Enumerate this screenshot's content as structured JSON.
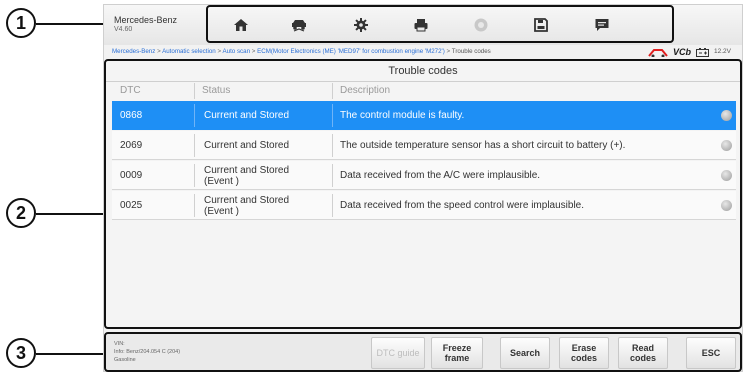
{
  "callouts": [
    "1",
    "2",
    "3"
  ],
  "app": {
    "name": "Mercedes-Benz",
    "version": "V4.60"
  },
  "toolbar": {
    "buttons": [
      {
        "icon": "home-icon"
      },
      {
        "icon": "vehicle-swap-icon"
      },
      {
        "icon": "gear-icon"
      },
      {
        "icon": "printer-icon"
      },
      {
        "icon": "help-icon"
      },
      {
        "icon": "save-icon"
      },
      {
        "icon": "message-icon"
      }
    ]
  },
  "breadcrumb": {
    "items": [
      "Mercedes-Benz",
      "Automatic selection",
      "Auto scan",
      "ECM(Motor Electronics (ME) 'MED97' for combustion engine 'M272')"
    ],
    "current": "Trouble codes",
    "separator": ">",
    "vci_label": "VCb",
    "voltage": "12.2V"
  },
  "panel": {
    "title": "Trouble codes",
    "columns": [
      "DTC",
      "Status",
      "Description"
    ],
    "rows": [
      {
        "dtc": "0868",
        "status": "Current and Stored",
        "description": "The control module is faulty.",
        "selected": true
      },
      {
        "dtc": "2069",
        "status": "Current and Stored",
        "description": "The outside temperature sensor has a short circuit to battery (+).",
        "selected": false
      },
      {
        "dtc": "0009",
        "status": "Current and Stored (Event )",
        "description": "Data received from the A/C were implausible.",
        "selected": false
      },
      {
        "dtc": "0025",
        "status": "Current and Stored (Event )",
        "description": "Data received from the speed control were implausible.",
        "selected": false
      }
    ]
  },
  "vehicle_info": {
    "vin": "VIN:",
    "model": "Info: Benz/204.054 C (204)",
    "engine": "Gasoline"
  },
  "function_buttons": [
    "DTC guide",
    "Freeze frame",
    "Search",
    "Erase codes",
    "Read codes",
    "ESC"
  ],
  "colors": {
    "selected_row": "#1e8ff5",
    "link": "#2a6fd6"
  }
}
